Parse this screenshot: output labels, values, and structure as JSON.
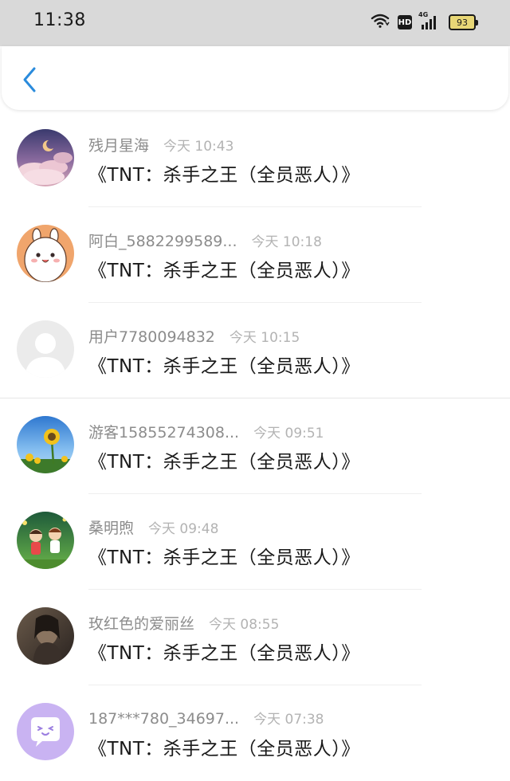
{
  "status_bar": {
    "time": "11:38",
    "network_label": "4G",
    "hd_label": "HD",
    "battery_level": "93"
  },
  "nav": {
    "back_icon": "chevron-left-icon",
    "accent_color": "#2a8bdc"
  },
  "comments": [
    {
      "name": "残月星海",
      "time": "今天 10:43",
      "text": "《TNT：杀手之王（全员恶人）》",
      "avatar": "night-sky-clouds"
    },
    {
      "name": "阿白_5882299589...",
      "time": "今天 10:18",
      "text": "《TNT：杀手之王（全员恶人）》",
      "avatar": "cartoon-bunny"
    },
    {
      "name": "用户7780094832",
      "time": "今天 10:15",
      "text": "《TNT：杀手之王（全员恶人）》",
      "avatar": "default-user"
    },
    {
      "name": "游客15855274308...",
      "time": "今天 09:51",
      "text": "《TNT：杀手之王（全员恶人）》",
      "avatar": "sunflower"
    },
    {
      "name": "桑明煦",
      "time": "今天 09:48",
      "text": "《TNT：杀手之王（全员恶人）》",
      "avatar": "cartoon-kids"
    },
    {
      "name": "玫红色的爱丽丝",
      "time": "今天 08:55",
      "text": "《TNT：杀手之王（全员恶人）》",
      "avatar": "dark-portrait"
    },
    {
      "name": "187***780_34697...",
      "time": "今天 07:38",
      "text": "《TNT：杀手之王（全员恶人）》",
      "avatar": "chat-bubble"
    }
  ]
}
